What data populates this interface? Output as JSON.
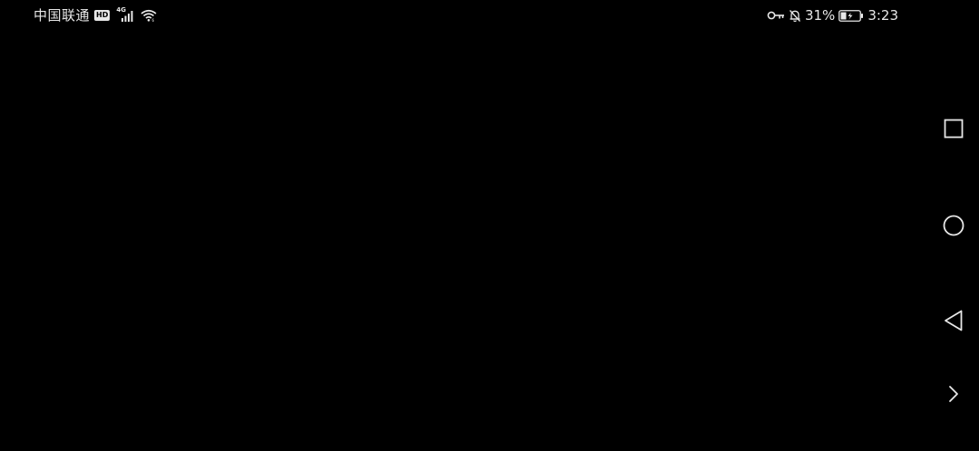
{
  "status_bar": {
    "carrier": "中国联通",
    "hd_badge": "HD",
    "network_type": "4G",
    "battery_percent": "31%",
    "time": "3:23",
    "icons": [
      "hd-badge",
      "signal-icon",
      "wifi-icon",
      "key-icon",
      "bell-muted-icon",
      "battery-icon"
    ],
    "battery_level": 0.31
  },
  "nav_bar": {
    "buttons": [
      "recent-apps-button",
      "home-button",
      "back-button",
      "expand-button"
    ]
  },
  "colors": {
    "background": "#000000",
    "foreground": "#e8e8e8"
  }
}
